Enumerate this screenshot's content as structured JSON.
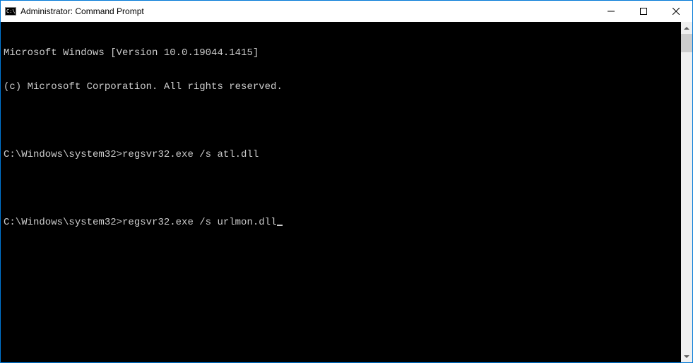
{
  "window": {
    "title": "Administrator: Command Prompt"
  },
  "console": {
    "header_line1": "Microsoft Windows [Version 10.0.19044.1415]",
    "header_line2": "(c) Microsoft Corporation. All rights reserved.",
    "prompts": [
      {
        "prompt": "C:\\Windows\\system32>",
        "command": "regsvr32.exe /s atl.dll"
      },
      {
        "prompt": "C:\\Windows\\system32>",
        "command": "regsvr32.exe /s urlmon.dll"
      }
    ]
  }
}
